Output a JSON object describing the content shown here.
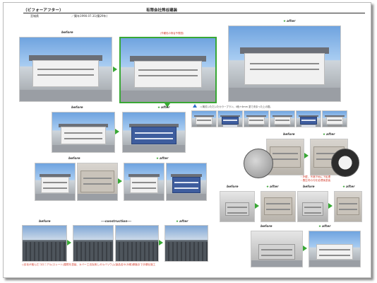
{
  "header": {
    "title": "（ビフォーアフター）",
    "company": "有限会社熊谷建装",
    "location": "宮城県",
    "year": "／築年1990.07.31(築29年)"
  },
  "labels": {
    "before": "before",
    "after": "after",
    "construction": "---construction---",
    "star": "★"
  },
  "notes": {
    "simulation": "(外観色の熊谷予想図)",
    "colorplan": "◁ 検討いただいたカラープラン。4色+4mm 塗で決まった上の図。",
    "repair_1": "・外壁、不適下地に下処理",
    "repair_2": "・養生材の汚を処理後塗装",
    "roof_caption": "◇劣化が進んだコロニアル(スレート)屋根を塗装、カバー工法採用しガルバリウム(製品名GL対候)鋼板まで手順仕施工"
  },
  "colors": {
    "accent": "#39a835",
    "frame": "#b9b9b9"
  }
}
